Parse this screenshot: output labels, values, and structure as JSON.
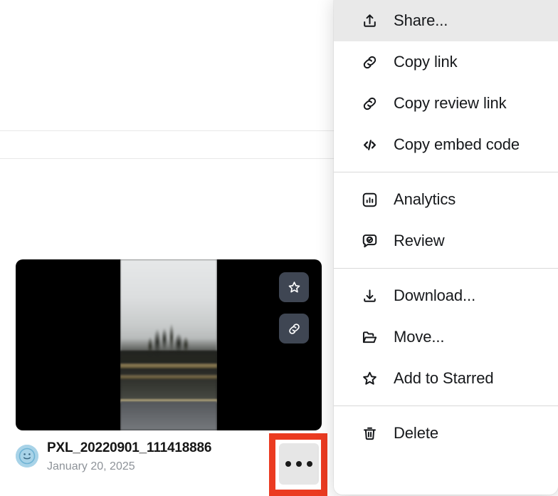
{
  "page": {
    "background_color": "#ffffff",
    "dividers": [
      "divider-top",
      "divider-sub"
    ]
  },
  "file_card": {
    "thumbnail": {
      "media_type": "video-frame",
      "background_color": "#000000",
      "description": "Blurry roadside view through a rain-streaked window with overcast sky",
      "actions": [
        {
          "name": "star-icon",
          "label": "Star"
        },
        {
          "name": "link-icon",
          "label": "Copy link"
        }
      ]
    },
    "avatar": {
      "icon": "smiley-face-avatar",
      "color": "#a8d3e8"
    },
    "file_name": "PXL_20220901_111418886",
    "file_date": "January 20, 2025",
    "more_button": {
      "icon": "three-dots-icon",
      "label": "More options",
      "background_color": "#e6e6e6"
    },
    "highlight": {
      "color": "#eb3b21",
      "border_width": "9px"
    }
  },
  "context_menu": {
    "background_color": "#ffffff",
    "highlight_color": "#e9e9e9",
    "groups": [
      {
        "items": [
          {
            "icon": "share-upload-icon",
            "label": "Share...",
            "highlighted": true
          },
          {
            "icon": "link-icon",
            "label": "Copy link",
            "highlighted": false
          },
          {
            "icon": "link-icon",
            "label": "Copy review link",
            "highlighted": false
          },
          {
            "icon": "embed-code-icon",
            "label": "Copy embed code",
            "highlighted": false
          }
        ]
      },
      {
        "items": [
          {
            "icon": "analytics-bar-chart-icon",
            "label": "Analytics",
            "highlighted": false
          },
          {
            "icon": "review-check-bubble-icon",
            "label": "Review",
            "highlighted": false
          }
        ]
      },
      {
        "items": [
          {
            "icon": "download-icon",
            "label": "Download...",
            "highlighted": false
          },
          {
            "icon": "folder-open-icon",
            "label": "Move...",
            "highlighted": false
          },
          {
            "icon": "star-icon",
            "label": "Add to Starred",
            "highlighted": false
          }
        ]
      },
      {
        "items": [
          {
            "icon": "trash-icon",
            "label": "Delete",
            "highlighted": false
          }
        ]
      }
    ]
  }
}
